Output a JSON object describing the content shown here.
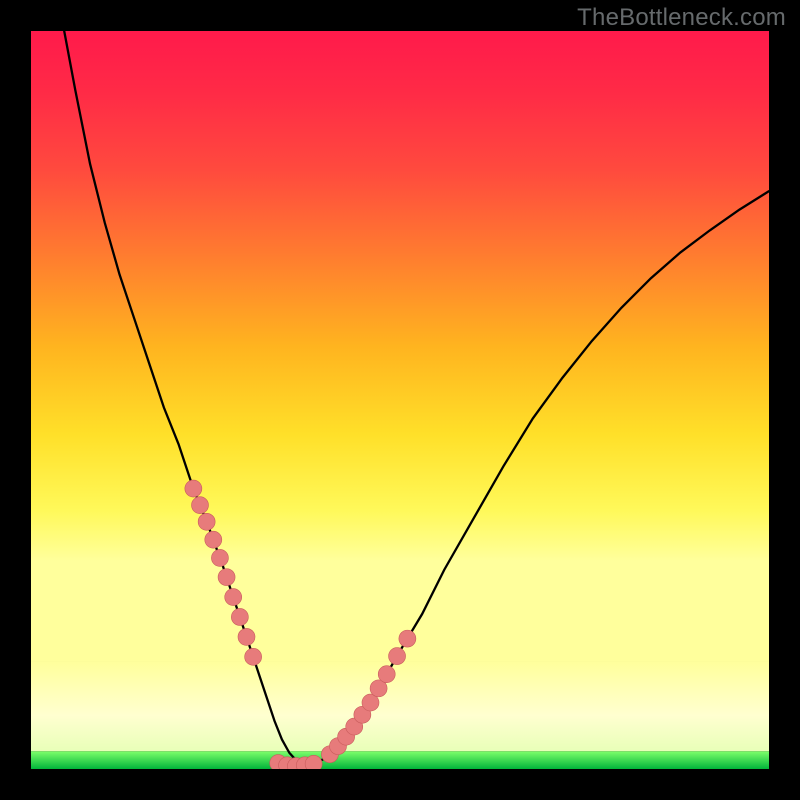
{
  "watermark": "TheBottleneck.com",
  "colors": {
    "frame": "#000000",
    "curve_stroke": "#000000",
    "dot_fill": "#e77b7b",
    "dot_stroke": "#c95c5c",
    "green_band_top": "#7dff6a",
    "green_band_bottom": "#00b43a",
    "pale_top": "#ffffc0"
  },
  "gradient_stops": [
    {
      "offset": 0.0,
      "color": "#ff1a4b"
    },
    {
      "offset": 0.1,
      "color": "#ff2b46"
    },
    {
      "offset": 0.22,
      "color": "#ff4a3e"
    },
    {
      "offset": 0.35,
      "color": "#ff7a30"
    },
    {
      "offset": 0.5,
      "color": "#ffb41f"
    },
    {
      "offset": 0.64,
      "color": "#ffe029"
    },
    {
      "offset": 0.76,
      "color": "#fff95a"
    },
    {
      "offset": 0.84,
      "color": "#ffff9c"
    }
  ],
  "chart_data": {
    "type": "line",
    "title": "",
    "xlabel": "",
    "ylabel": "",
    "xlim": [
      0,
      100
    ],
    "ylim": [
      0,
      100
    ],
    "series": [
      {
        "name": "curve",
        "x": [
          4.5,
          6,
          8,
          10,
          12,
          14,
          16,
          18,
          20,
          22,
          24,
          26,
          27,
          28,
          29,
          30,
          31,
          32,
          33,
          34,
          35,
          36,
          37,
          38,
          40,
          42,
          44,
          46,
          48,
          50,
          53,
          56,
          60,
          64,
          68,
          72,
          76,
          80,
          84,
          88,
          92,
          96,
          100
        ],
        "y": [
          100,
          92,
          82,
          74,
          67,
          61,
          55,
          49,
          44,
          38,
          33,
          27.5,
          24.5,
          21.5,
          18.5,
          15.5,
          12.5,
          9.5,
          6.5,
          4,
          2.2,
          1.1,
          0.6,
          0.6,
          1.5,
          3.5,
          6,
          9,
          12.5,
          16,
          21,
          27,
          34,
          41,
          47.5,
          53,
          58,
          62.5,
          66.5,
          70,
          73,
          75.8,
          78.3
        ]
      }
    ],
    "marker_clusters": {
      "left": {
        "x": [
          22.0,
          22.9,
          23.8,
          24.7,
          25.6,
          26.5,
          27.4,
          28.3,
          29.2,
          30.1
        ],
        "y_from_curve": true
      },
      "right": {
        "x": [
          40.5,
          41.6,
          42.7,
          43.8,
          44.9,
          46.0,
          47.1,
          48.2,
          49.6,
          51.0
        ],
        "y_from_curve": true
      },
      "bottom": {
        "x": [
          33.5,
          34.7,
          35.9,
          37.1,
          38.3
        ],
        "y": [
          0.8,
          0.5,
          0.4,
          0.5,
          0.7
        ]
      }
    },
    "marker_radius_px": 8.5,
    "green_band_y_range": [
      0.0,
      2.4
    ],
    "pale_band_y_range": [
      2.4,
      14.5
    ]
  }
}
